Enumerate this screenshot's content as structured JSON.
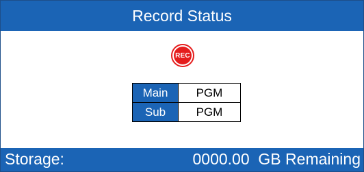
{
  "header": {
    "title": "Record Status"
  },
  "record": {
    "label": "REC"
  },
  "outputs": [
    {
      "label": "Main",
      "value": "PGM"
    },
    {
      "label": "Sub",
      "value": "PGM"
    }
  ],
  "footer": {
    "storage_label": "Storage:",
    "storage_value": "0000.00  GB Remaining"
  },
  "colors": {
    "header_bg": "#1b64b5",
    "record_red": "#e51c1c",
    "text_light": "#ffffff"
  },
  "icons": {
    "record": "record-icon"
  }
}
